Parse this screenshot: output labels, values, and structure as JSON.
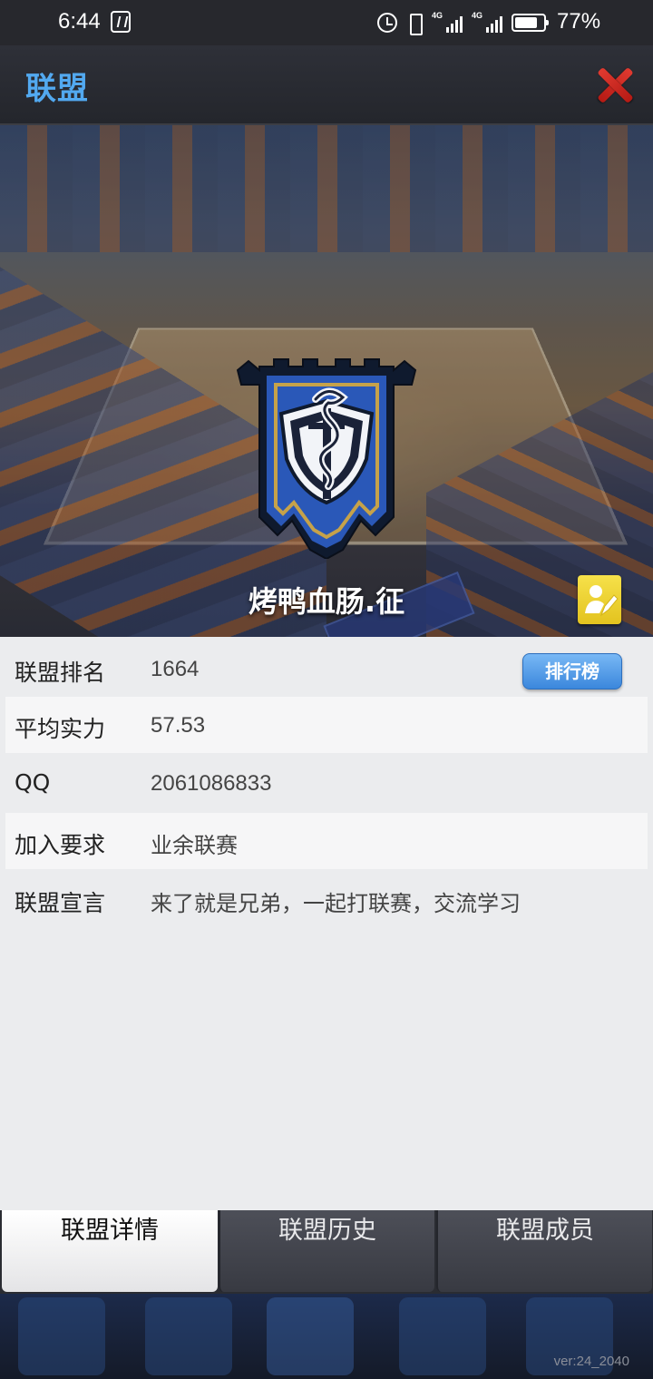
{
  "status_bar": {
    "time": "6:44",
    "battery_percent": "77%",
    "network_label_1": "4G",
    "network_label_2": "4G",
    "icons": [
      "nfc-icon",
      "alarm-icon",
      "vibrate-icon",
      "signal-icon",
      "signal-icon",
      "battery-icon"
    ]
  },
  "header": {
    "title": "联盟",
    "close_icon": "close-icon",
    "accent_color": "#52a9f0"
  },
  "banner": {
    "alliance_name": "烤鸭血肠.征",
    "emblem_icon": "alliance-emblem-icon",
    "edit_icon": "edit-icon"
  },
  "info": {
    "rank": {
      "label": "联盟排名",
      "value": "1664",
      "button_label": "排行榜"
    },
    "avg_power": {
      "label": "平均实力",
      "value": "57.53"
    },
    "qq": {
      "label": "QQ",
      "value": "2061086833"
    },
    "join_req": {
      "label": "加入要求",
      "value": "业余联赛"
    },
    "declaration": {
      "label": "联盟宣言",
      "value": "来了就是兄弟，一起打联赛，交流学习"
    }
  },
  "tabs": [
    {
      "label": "联盟详情",
      "active": true
    },
    {
      "label": "联盟历史",
      "active": false
    },
    {
      "label": "联盟成员",
      "active": false
    }
  ],
  "footer": {
    "version": "ver:24_2040"
  }
}
